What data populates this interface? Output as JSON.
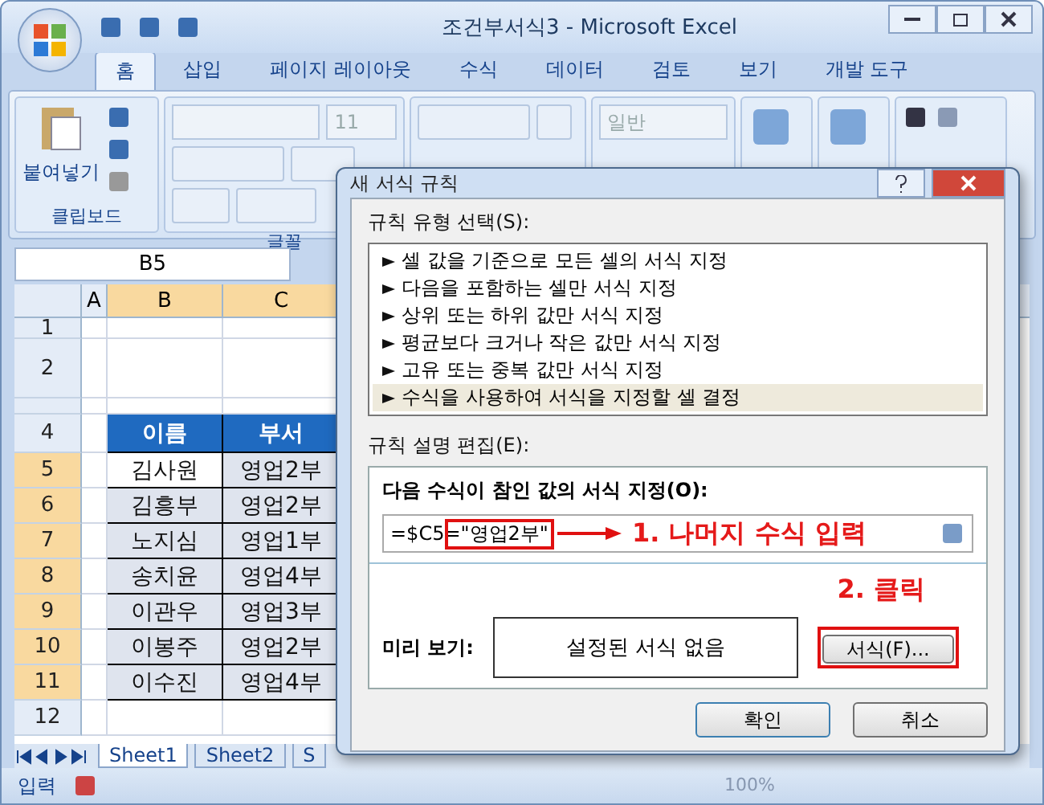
{
  "window": {
    "title": "조건부서식3 - Microsoft Excel"
  },
  "ribbon_tabs": [
    {
      "label": "홈",
      "selected": true
    },
    {
      "label": "삽입",
      "selected": false
    },
    {
      "label": "페이지 레이아웃",
      "selected": false
    },
    {
      "label": "수식",
      "selected": false
    },
    {
      "label": "데이터",
      "selected": false
    },
    {
      "label": "검토",
      "selected": false
    },
    {
      "label": "보기",
      "selected": false
    },
    {
      "label": "개발 도구",
      "selected": false
    }
  ],
  "ribbon": {
    "paste_label": "붙여넣기",
    "font_size": "11",
    "number_format": "일반",
    "groups": [
      "클립보드",
      "글꼴"
    ]
  },
  "name_box": "B5",
  "columns": [
    "A",
    "B",
    "C"
  ],
  "rows": [
    {
      "number": "1",
      "cells": [
        "",
        ""
      ]
    },
    {
      "number": "2",
      "cells": [
        "",
        ""
      ]
    },
    {
      "number": "4",
      "cells": [
        "이름",
        "부서"
      ],
      "header": true
    },
    {
      "number": "5",
      "cells": [
        "김사원",
        "영업2부"
      ]
    },
    {
      "number": "6",
      "cells": [
        "김흥부",
        "영업2부"
      ]
    },
    {
      "number": "7",
      "cells": [
        "노지심",
        "영업1부"
      ]
    },
    {
      "number": "8",
      "cells": [
        "송치윤",
        "영업4부"
      ]
    },
    {
      "number": "9",
      "cells": [
        "이관우",
        "영업3부"
      ]
    },
    {
      "number": "10",
      "cells": [
        "이봉주",
        "영업2부"
      ]
    },
    {
      "number": "11",
      "cells": [
        "이수진",
        "영업4부"
      ]
    },
    {
      "number": "12",
      "cells": [
        "",
        ""
      ]
    }
  ],
  "sheet_tabs": [
    {
      "label": "Sheet1",
      "selected": true
    },
    {
      "label": "Sheet2",
      "selected": false
    },
    {
      "label": "S",
      "selected": false
    }
  ],
  "status_bar": {
    "mode": "입력",
    "zoom": "100%"
  },
  "dialog": {
    "title": "새 서식 규칙",
    "rule_type_label": "규칙 유형 선택(S):",
    "rule_types": [
      {
        "label": "셀 값을 기준으로 모든 셀의 서식 지정",
        "selected": false
      },
      {
        "label": "다음을 포함하는 셀만 서식 지정",
        "selected": false
      },
      {
        "label": "상위 또는 하위 값만 서식 지정",
        "selected": false
      },
      {
        "label": "평균보다 크거나 작은 값만 서식 지정",
        "selected": false
      },
      {
        "label": "고유 또는 중복 값만 서식 지정",
        "selected": false
      },
      {
        "label": "수식을 사용하여 서식을 지정할 셀 결정",
        "selected": true
      }
    ],
    "edit_label": "규칙 설명 편집(E):",
    "formula_label": "다음 수식이 참인 값의 서식 지정(O):",
    "formula_value": "=$C5=\"영업2부\"",
    "annotation_1": "1. 나머지 수식 입력",
    "annotation_2": "2. 클릭",
    "preview_label": "미리 보기:",
    "preview_text": "설정된 서식 없음",
    "format_button": "서식(F)...",
    "ok_button": "확인",
    "cancel_button": "취소"
  }
}
